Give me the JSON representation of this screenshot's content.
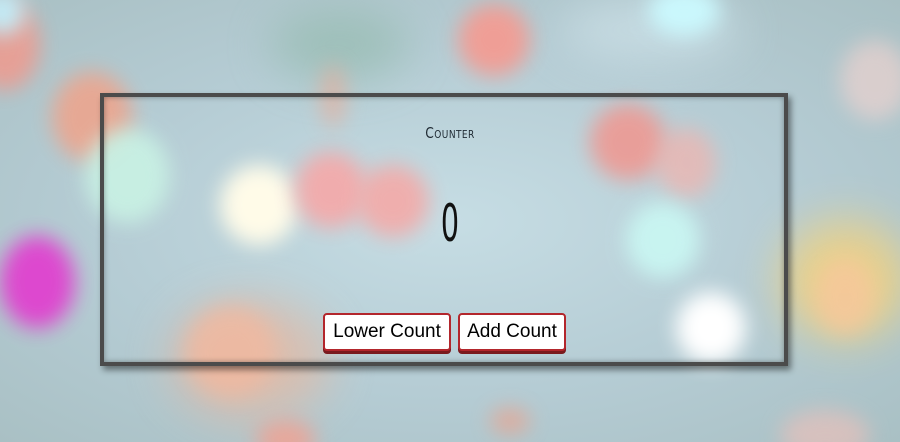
{
  "counter": {
    "title": "Counter",
    "value": "0"
  },
  "buttons": {
    "lower_label": "Lower Count",
    "add_label": "Add Count"
  },
  "colors": {
    "button_border": "#b3262c",
    "panel_border": "#4b4b4b"
  }
}
